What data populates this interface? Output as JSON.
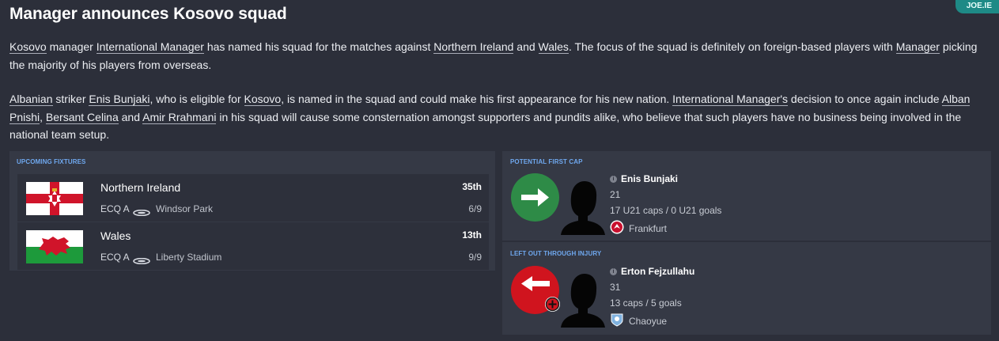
{
  "header": {
    "title": "Manager announces Kosovo squad",
    "badge": "JOE.IE"
  },
  "article": {
    "p1": {
      "t1": "Kosovo",
      "t2": " manager ",
      "t3": "International Manager",
      "t4": " has named his squad for the matches against ",
      "t5": "Northern Ireland",
      "t6": " and ",
      "t7": "Wales",
      "t8": ". The focus of the squad is definitely on foreign-based players with ",
      "t9": "Manager",
      "t10": " picking the majority of his players from overseas."
    },
    "p2": {
      "t1": "Albanian",
      "t2": " striker ",
      "t3": "Enis Bunjaki",
      "t4": ", who is eligible for ",
      "t5": "Kosovo",
      "t6": ", is named in the squad and could make his first appearance for his new nation. ",
      "t7": "International Manager's",
      "t8": " decision to once again include ",
      "t9": "Alban Pnishi",
      "t10": ", ",
      "t11": "Bersant Celina",
      "t12": " and ",
      "t13": "Amir Rrahmani",
      "t14": " in his squad will cause some consternation amongst supporters and pundits alike, who believe that such players have no business being involved in the national team setup."
    }
  },
  "fixtures": {
    "title": "UPCOMING FIXTURES",
    "rows": [
      {
        "flag": "northern-ireland-flag",
        "team": "Northern Ireland",
        "competition": "ECQ A",
        "venue": "Windsor Park",
        "position": "35th",
        "record": "6/9"
      },
      {
        "flag": "wales-flag",
        "team": "Wales",
        "competition": "ECQ A",
        "venue": "Liberty Stadium",
        "position": "13th",
        "record": "9/9"
      }
    ]
  },
  "first_cap": {
    "title": "POTENTIAL FIRST CAP",
    "name": "Enis Bunjaki",
    "age": "21",
    "caps": "17 U21 caps / 0 U21 goals",
    "club": "Frankfurt",
    "icon": "arrow-right-icon",
    "color": "#2e8b47"
  },
  "injury": {
    "title": "LEFT OUT THROUGH INJURY",
    "name": "Erton Fejzullahu",
    "age": "31",
    "caps": "13 caps / 5 goals",
    "club": "Chaoyue",
    "icon": "arrow-left-icon",
    "color": "#d0141e"
  }
}
